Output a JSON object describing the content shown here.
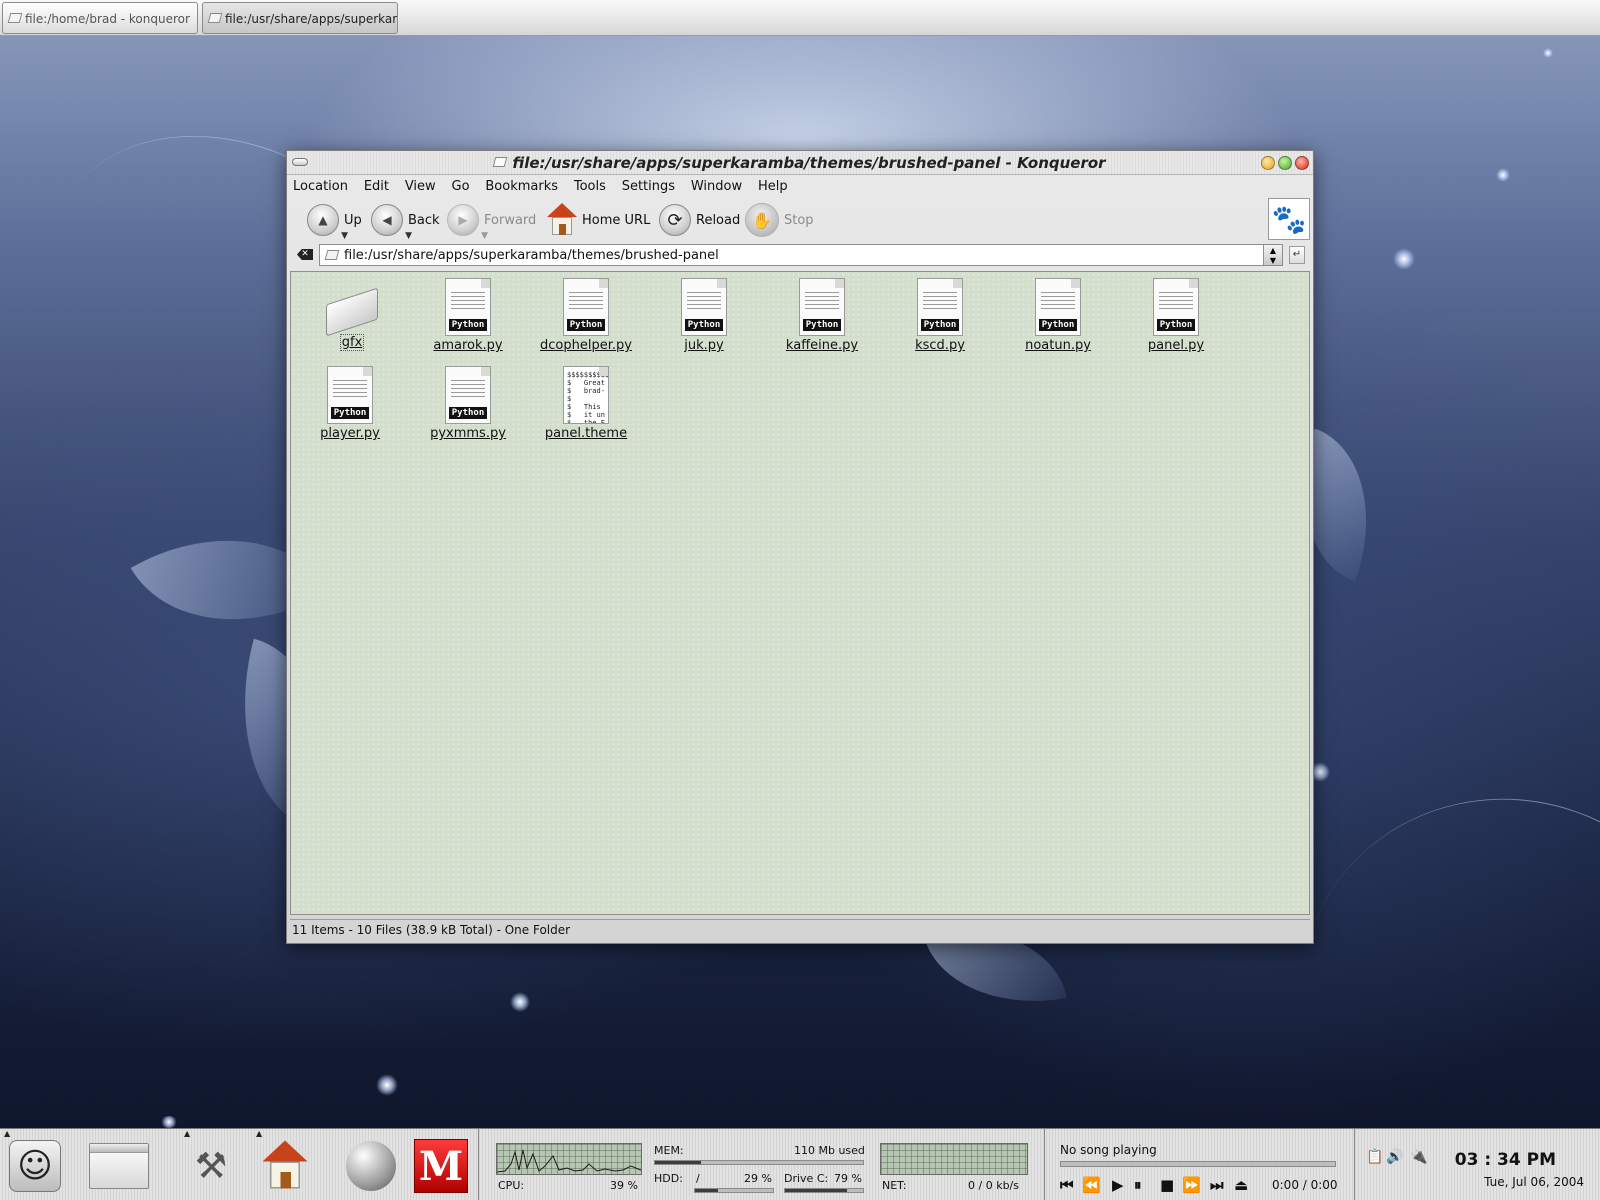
{
  "top_tabs": [
    {
      "label": "file:/home/brad - konqueror"
    },
    {
      "label": "file:/usr/share/apps/superkaramba/themes/brushed-panel - Konqueror"
    }
  ],
  "window": {
    "title": "file:/usr/share/apps/superkaramba/themes/brushed-panel - Konqueror",
    "menu": [
      "Location",
      "Edit",
      "View",
      "Go",
      "Bookmarks",
      "Tools",
      "Settings",
      "Window",
      "Help"
    ],
    "toolbar": {
      "up": "Up",
      "back": "Back",
      "forward": "Forward",
      "home": "Home URL",
      "reload": "Reload",
      "stop": "Stop"
    },
    "location": "file:/usr/share/apps/superkaramba/themes/brushed-panel",
    "files": [
      {
        "name": "gfx",
        "type": "folder"
      },
      {
        "name": "amarok.py",
        "type": "python"
      },
      {
        "name": "dcophelper.py",
        "type": "python"
      },
      {
        "name": "juk.py",
        "type": "python"
      },
      {
        "name": "kaffeine.py",
        "type": "python"
      },
      {
        "name": "kscd.py",
        "type": "python"
      },
      {
        "name": "noatun.py",
        "type": "python"
      },
      {
        "name": "panel.py",
        "type": "python"
      },
      {
        "name": "player.py",
        "type": "python"
      },
      {
        "name": "pyxmms.py",
        "type": "python"
      },
      {
        "name": "panel.theme",
        "type": "theme"
      }
    ],
    "python_badge": "Python",
    "theme_preview": "$$$$$$$$$$\n$   Great\n$   brad-\n$\n$   This\n$   it un\n$   the F",
    "status": "11 Items - 10 Files (38.9 kB Total) - One Folder"
  },
  "panel": {
    "monitors": {
      "mem_label": "MEM:",
      "mem_value": "110 Mb used",
      "mem_fraction": 0.22,
      "cpu_label": "CPU:",
      "cpu_value": "39 %",
      "hdd_label": "HDD:",
      "hdd_mount": "/",
      "hdd_value": "29 %",
      "hdd_fraction": 0.29,
      "drivec_label": "Drive C:",
      "drivec_value": "79 %",
      "drivec_fraction": 0.79,
      "net_label": "NET:",
      "net_value": "0 / 0 kb/s"
    },
    "player": {
      "song": "No song playing",
      "time": "0:00 / 0:00"
    },
    "clock": {
      "time": "03 : 34  PM",
      "date": "Tue, Jul 06, 2004"
    }
  },
  "icons": {
    "up": "up-arrow-icon",
    "back": "back-arrow-icon",
    "forward": "forward-arrow-icon",
    "home": "home-icon",
    "reload": "reload-icon",
    "stop": "stop-hand-icon",
    "throbber": "paw-icon"
  }
}
